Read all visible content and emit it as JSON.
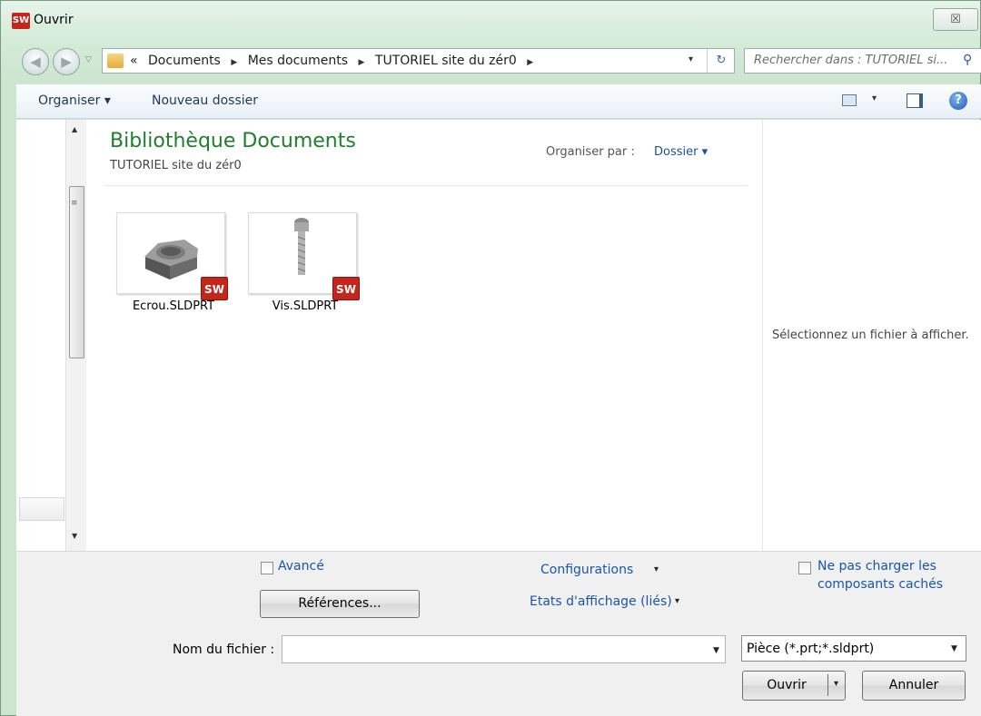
{
  "window": {
    "title": "Ouvrir",
    "app_logo": "SW",
    "close_glyph": "☒"
  },
  "nav": {
    "back_glyph": "◀",
    "forward_glyph": "▶",
    "recent_glyph": "▽"
  },
  "address": {
    "overflow": "«",
    "crumbs": [
      "Documents",
      "Mes documents",
      "TUTORIEL site du zér0"
    ],
    "separator": "▶",
    "dropdown_glyph": "▾",
    "refresh_glyph": "↻"
  },
  "search": {
    "placeholder": "Rechercher dans : TUTORIEL si...",
    "icon_glyph": "⚲"
  },
  "toolbar": {
    "organize": "Organiser ▾",
    "new_folder": "Nouveau dossier",
    "view_dropdown": "▾",
    "help": "?"
  },
  "library": {
    "title": "Bibliothèque Documents",
    "subtitle": "TUTORIEL site du zér0",
    "arrange_label": "Organiser par :",
    "arrange_value": "Dossier ▾"
  },
  "files": [
    {
      "name": "Ecrou.SLDPRT",
      "icon": "hex-nut-part-icon",
      "badge": "SW"
    },
    {
      "name": "Vis.SLDPRT",
      "icon": "screw-part-icon",
      "badge": "SW"
    }
  ],
  "scrollbar": {
    "up": "▲",
    "down": "▼",
    "grip": "≡"
  },
  "preview": {
    "message": "Sélectionnez un fichier à afficher."
  },
  "options": {
    "advanced": "Avancé",
    "configurations": "Configurations",
    "display_states": "Etats d'affichage (liés)",
    "references_button": "Références...",
    "hidden_components_line1": "Ne pas charger les",
    "hidden_components_line2": "composants cachés",
    "caret": "▾"
  },
  "file_name": {
    "label": "Nom du fichier :",
    "value": "",
    "dropdown_glyph": "▼"
  },
  "file_type": {
    "value": "Pièce (*.prt;*.sldprt)",
    "dropdown_glyph": "▼"
  },
  "buttons": {
    "open": "Ouvrir",
    "open_dropdown": "▾",
    "cancel": "Annuler"
  },
  "colors": {
    "accent_green": "#1e7f2c",
    "link_blue": "#1a56a8",
    "solidworks_red": "#c4261c"
  }
}
